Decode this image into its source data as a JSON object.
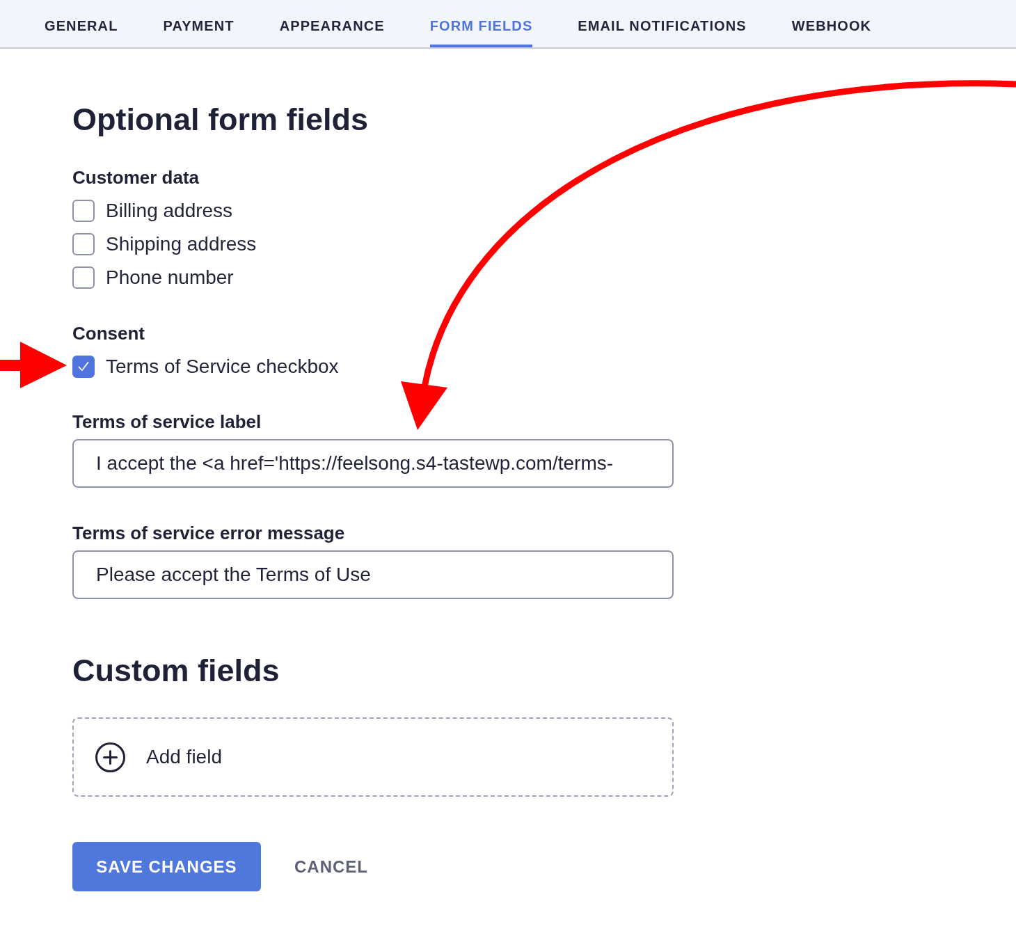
{
  "tabs": [
    {
      "label": "GENERAL",
      "selected": false
    },
    {
      "label": "PAYMENT",
      "selected": false
    },
    {
      "label": "APPEARANCE",
      "selected": false
    },
    {
      "label": "FORM FIELDS",
      "selected": true
    },
    {
      "label": "EMAIL NOTIFICATIONS",
      "selected": false
    },
    {
      "label": "WEBHOOK",
      "selected": false
    }
  ],
  "optional_fields": {
    "title": "Optional form fields",
    "groups": [
      {
        "label": "Customer data",
        "options": [
          {
            "label": "Billing address",
            "checked": false
          },
          {
            "label": "Shipping address",
            "checked": false
          },
          {
            "label": "Phone number",
            "checked": false
          }
        ]
      },
      {
        "label": "Consent",
        "options": [
          {
            "label": "Terms of Service checkbox",
            "checked": true
          }
        ]
      }
    ],
    "fields": [
      {
        "label": "Terms of service label",
        "value": "I accept the <a href='https://feelsong.s4-tastewp.com/terms-"
      },
      {
        "label": "Terms of service error message",
        "value": "Please accept the Terms of Use"
      }
    ]
  },
  "custom_fields": {
    "title": "Custom fields",
    "add_button": "Add field"
  },
  "buttons": [
    {
      "label": "SAVE CHANGES",
      "kind": "primary"
    },
    {
      "label": "CANCEL",
      "kind": "link"
    }
  ]
}
